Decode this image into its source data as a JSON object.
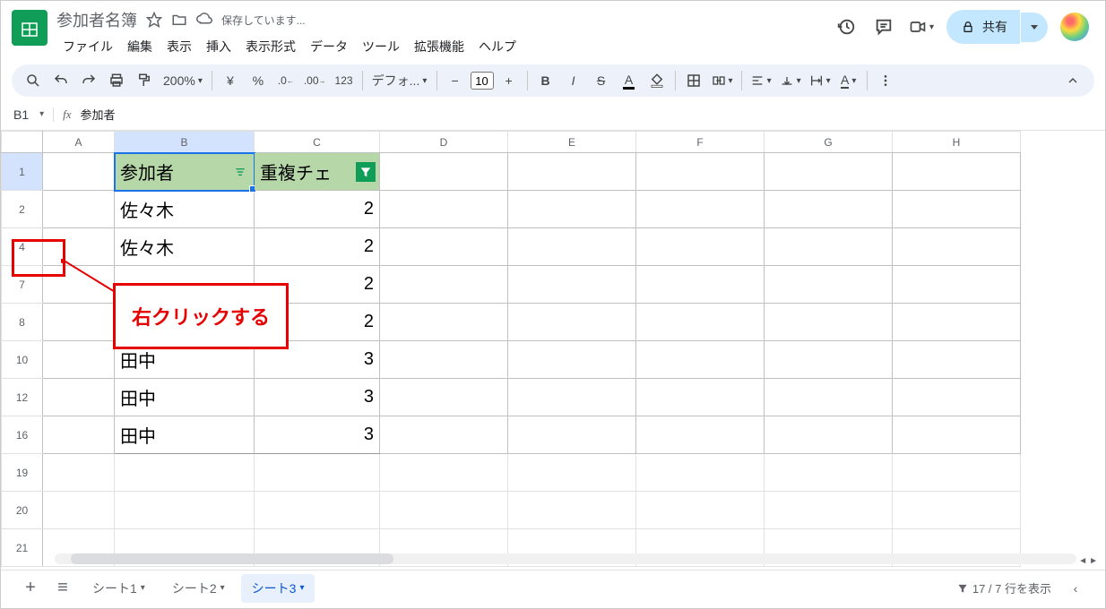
{
  "doc": {
    "title": "参加者名簿",
    "save_status": "保存しています..."
  },
  "menus": [
    "ファイル",
    "編集",
    "表示",
    "挿入",
    "表示形式",
    "データ",
    "ツール",
    "拡張機能",
    "ヘルプ"
  ],
  "share": {
    "label": "共有"
  },
  "toolbar": {
    "zoom": "200%",
    "font": "デフォ...",
    "font_size": "10"
  },
  "namebox": {
    "cell": "B1",
    "formula": "参加者"
  },
  "columns": [
    "A",
    "B",
    "C",
    "D",
    "E",
    "F",
    "G",
    "H"
  ],
  "rows": [
    {
      "n": "1",
      "a": "",
      "b": "参加者",
      "c": "重複チェ",
      "header": true
    },
    {
      "n": "2",
      "a": "",
      "b": "佐々木",
      "c": "2"
    },
    {
      "n": "4",
      "a": "",
      "b": "佐々木",
      "c": "2"
    },
    {
      "n": "7",
      "a": "",
      "b": "",
      "c": "2"
    },
    {
      "n": "8",
      "a": "",
      "b": "",
      "c": "2"
    },
    {
      "n": "10",
      "a": "",
      "b": "田中",
      "c": "3"
    },
    {
      "n": "12",
      "a": "",
      "b": "田中",
      "c": "3"
    },
    {
      "n": "16",
      "a": "",
      "b": "田中",
      "c": "3"
    },
    {
      "n": "19",
      "a": "",
      "b": "",
      "c": ""
    },
    {
      "n": "20",
      "a": "",
      "b": "",
      "c": ""
    },
    {
      "n": "21",
      "a": "",
      "b": "",
      "c": ""
    }
  ],
  "annotation": {
    "text": "右クリックする"
  },
  "sheets": {
    "tabs": [
      {
        "label": "シート1",
        "active": false
      },
      {
        "label": "シート2",
        "active": false
      },
      {
        "label": "シート3",
        "active": true
      }
    ]
  },
  "status": {
    "filter": "17 / 7 行を表示"
  }
}
